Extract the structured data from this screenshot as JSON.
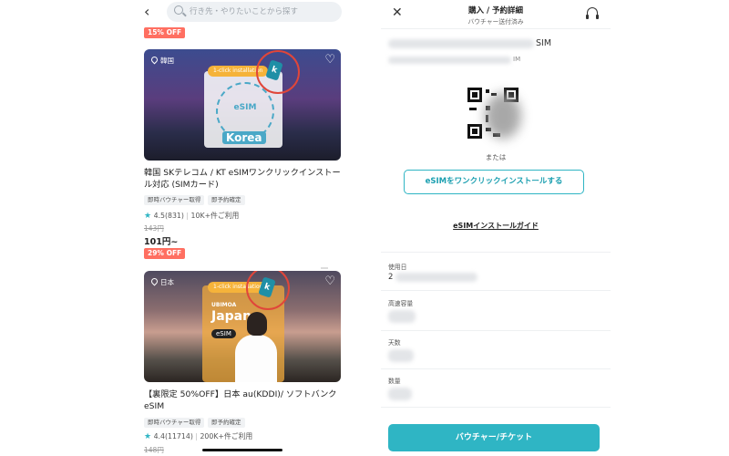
{
  "left": {
    "search": {
      "placeholder": "行き先・やりたいことから探す"
    },
    "top_badge": "15% OFF",
    "products": [
      {
        "location": "韓国",
        "promo_pill": "1-click installation",
        "image_caption": "Korea",
        "esim_text": "eSIM",
        "title": "韓国 SKテレコム / KT eSIMワンクリックインストール対応 (SIMカード)",
        "tags": [
          "即時バウチャー取得",
          "即予約確定"
        ],
        "rating": "4.5",
        "review_count": "(831)",
        "booked": "10K+件ご利用",
        "original_price": "143円",
        "price": "101円~",
        "discount_badge": "29% OFF"
      },
      {
        "location": "日本",
        "promo_pill": "1-click installation",
        "image_caption": "Japan",
        "image_brand": "UBIMOA",
        "esim_text": "eSIM",
        "title": "【裏限定 50%OFF】日本 au(KDDI)/ ソフトバンク eSIM",
        "tags": [
          "即時バウチャー取得",
          "即予約確定"
        ],
        "rating": "4.4",
        "review_count": "(11714)",
        "booked": "200K+件ご利用",
        "original_price": "148円"
      }
    ],
    "icons": {
      "back": "‹",
      "heart": "♡",
      "star": "★"
    }
  },
  "right": {
    "header": {
      "title": "購入 / 予約詳細",
      "subtitle": "バウチャー送付済み"
    },
    "sim_name_tail": "SIM",
    "sim_sub_tail": "IM",
    "or_text": "または",
    "install_button": "eSIMをワンクリックインストールする",
    "guide_link": "eSIMインストールガイド",
    "fields": [
      {
        "label": "使用日",
        "lead": "2"
      },
      {
        "label": "高速容量",
        "lead": ""
      },
      {
        "label": "天数",
        "lead": ""
      },
      {
        "label": "数量",
        "lead": ""
      }
    ],
    "voucher_button": "バウチャー/チケット",
    "icons": {
      "close": "✕",
      "support": "headset-icon"
    }
  },
  "colors": {
    "accent": "#2fb5c4",
    "discount": "#ff6f61",
    "annotation": "#e0463a"
  }
}
